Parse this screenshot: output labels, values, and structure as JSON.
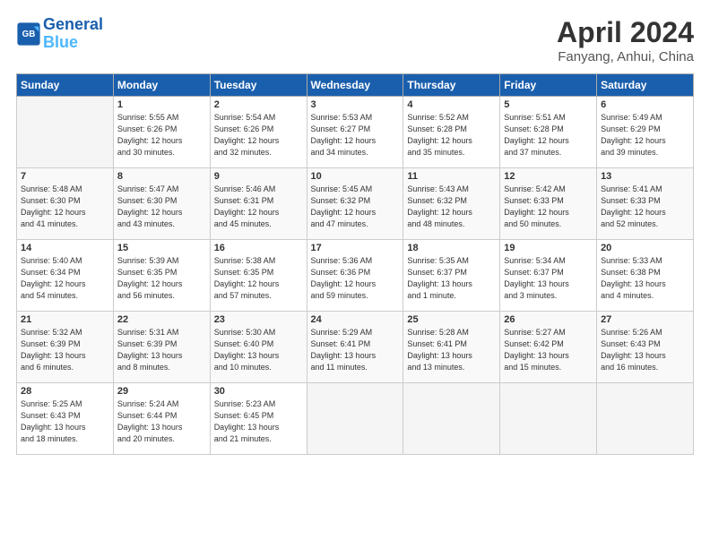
{
  "logo": {
    "line1": "General",
    "line2": "Blue"
  },
  "title": "April 2024",
  "subtitle": "Fanyang, Anhui, China",
  "days_of_week": [
    "Sunday",
    "Monday",
    "Tuesday",
    "Wednesday",
    "Thursday",
    "Friday",
    "Saturday"
  ],
  "weeks": [
    [
      {
        "day": "",
        "info": ""
      },
      {
        "day": "1",
        "info": "Sunrise: 5:55 AM\nSunset: 6:26 PM\nDaylight: 12 hours\nand 30 minutes."
      },
      {
        "day": "2",
        "info": "Sunrise: 5:54 AM\nSunset: 6:26 PM\nDaylight: 12 hours\nand 32 minutes."
      },
      {
        "day": "3",
        "info": "Sunrise: 5:53 AM\nSunset: 6:27 PM\nDaylight: 12 hours\nand 34 minutes."
      },
      {
        "day": "4",
        "info": "Sunrise: 5:52 AM\nSunset: 6:28 PM\nDaylight: 12 hours\nand 35 minutes."
      },
      {
        "day": "5",
        "info": "Sunrise: 5:51 AM\nSunset: 6:28 PM\nDaylight: 12 hours\nand 37 minutes."
      },
      {
        "day": "6",
        "info": "Sunrise: 5:49 AM\nSunset: 6:29 PM\nDaylight: 12 hours\nand 39 minutes."
      }
    ],
    [
      {
        "day": "7",
        "info": "Sunrise: 5:48 AM\nSunset: 6:30 PM\nDaylight: 12 hours\nand 41 minutes."
      },
      {
        "day": "8",
        "info": "Sunrise: 5:47 AM\nSunset: 6:30 PM\nDaylight: 12 hours\nand 43 minutes."
      },
      {
        "day": "9",
        "info": "Sunrise: 5:46 AM\nSunset: 6:31 PM\nDaylight: 12 hours\nand 45 minutes."
      },
      {
        "day": "10",
        "info": "Sunrise: 5:45 AM\nSunset: 6:32 PM\nDaylight: 12 hours\nand 47 minutes."
      },
      {
        "day": "11",
        "info": "Sunrise: 5:43 AM\nSunset: 6:32 PM\nDaylight: 12 hours\nand 48 minutes."
      },
      {
        "day": "12",
        "info": "Sunrise: 5:42 AM\nSunset: 6:33 PM\nDaylight: 12 hours\nand 50 minutes."
      },
      {
        "day": "13",
        "info": "Sunrise: 5:41 AM\nSunset: 6:33 PM\nDaylight: 12 hours\nand 52 minutes."
      }
    ],
    [
      {
        "day": "14",
        "info": "Sunrise: 5:40 AM\nSunset: 6:34 PM\nDaylight: 12 hours\nand 54 minutes."
      },
      {
        "day": "15",
        "info": "Sunrise: 5:39 AM\nSunset: 6:35 PM\nDaylight: 12 hours\nand 56 minutes."
      },
      {
        "day": "16",
        "info": "Sunrise: 5:38 AM\nSunset: 6:35 PM\nDaylight: 12 hours\nand 57 minutes."
      },
      {
        "day": "17",
        "info": "Sunrise: 5:36 AM\nSunset: 6:36 PM\nDaylight: 12 hours\nand 59 minutes."
      },
      {
        "day": "18",
        "info": "Sunrise: 5:35 AM\nSunset: 6:37 PM\nDaylight: 13 hours\nand 1 minute."
      },
      {
        "day": "19",
        "info": "Sunrise: 5:34 AM\nSunset: 6:37 PM\nDaylight: 13 hours\nand 3 minutes."
      },
      {
        "day": "20",
        "info": "Sunrise: 5:33 AM\nSunset: 6:38 PM\nDaylight: 13 hours\nand 4 minutes."
      }
    ],
    [
      {
        "day": "21",
        "info": "Sunrise: 5:32 AM\nSunset: 6:39 PM\nDaylight: 13 hours\nand 6 minutes."
      },
      {
        "day": "22",
        "info": "Sunrise: 5:31 AM\nSunset: 6:39 PM\nDaylight: 13 hours\nand 8 minutes."
      },
      {
        "day": "23",
        "info": "Sunrise: 5:30 AM\nSunset: 6:40 PM\nDaylight: 13 hours\nand 10 minutes."
      },
      {
        "day": "24",
        "info": "Sunrise: 5:29 AM\nSunset: 6:41 PM\nDaylight: 13 hours\nand 11 minutes."
      },
      {
        "day": "25",
        "info": "Sunrise: 5:28 AM\nSunset: 6:41 PM\nDaylight: 13 hours\nand 13 minutes."
      },
      {
        "day": "26",
        "info": "Sunrise: 5:27 AM\nSunset: 6:42 PM\nDaylight: 13 hours\nand 15 minutes."
      },
      {
        "day": "27",
        "info": "Sunrise: 5:26 AM\nSunset: 6:43 PM\nDaylight: 13 hours\nand 16 minutes."
      }
    ],
    [
      {
        "day": "28",
        "info": "Sunrise: 5:25 AM\nSunset: 6:43 PM\nDaylight: 13 hours\nand 18 minutes."
      },
      {
        "day": "29",
        "info": "Sunrise: 5:24 AM\nSunset: 6:44 PM\nDaylight: 13 hours\nand 20 minutes."
      },
      {
        "day": "30",
        "info": "Sunrise: 5:23 AM\nSunset: 6:45 PM\nDaylight: 13 hours\nand 21 minutes."
      },
      {
        "day": "",
        "info": ""
      },
      {
        "day": "",
        "info": ""
      },
      {
        "day": "",
        "info": ""
      },
      {
        "day": "",
        "info": ""
      }
    ]
  ]
}
